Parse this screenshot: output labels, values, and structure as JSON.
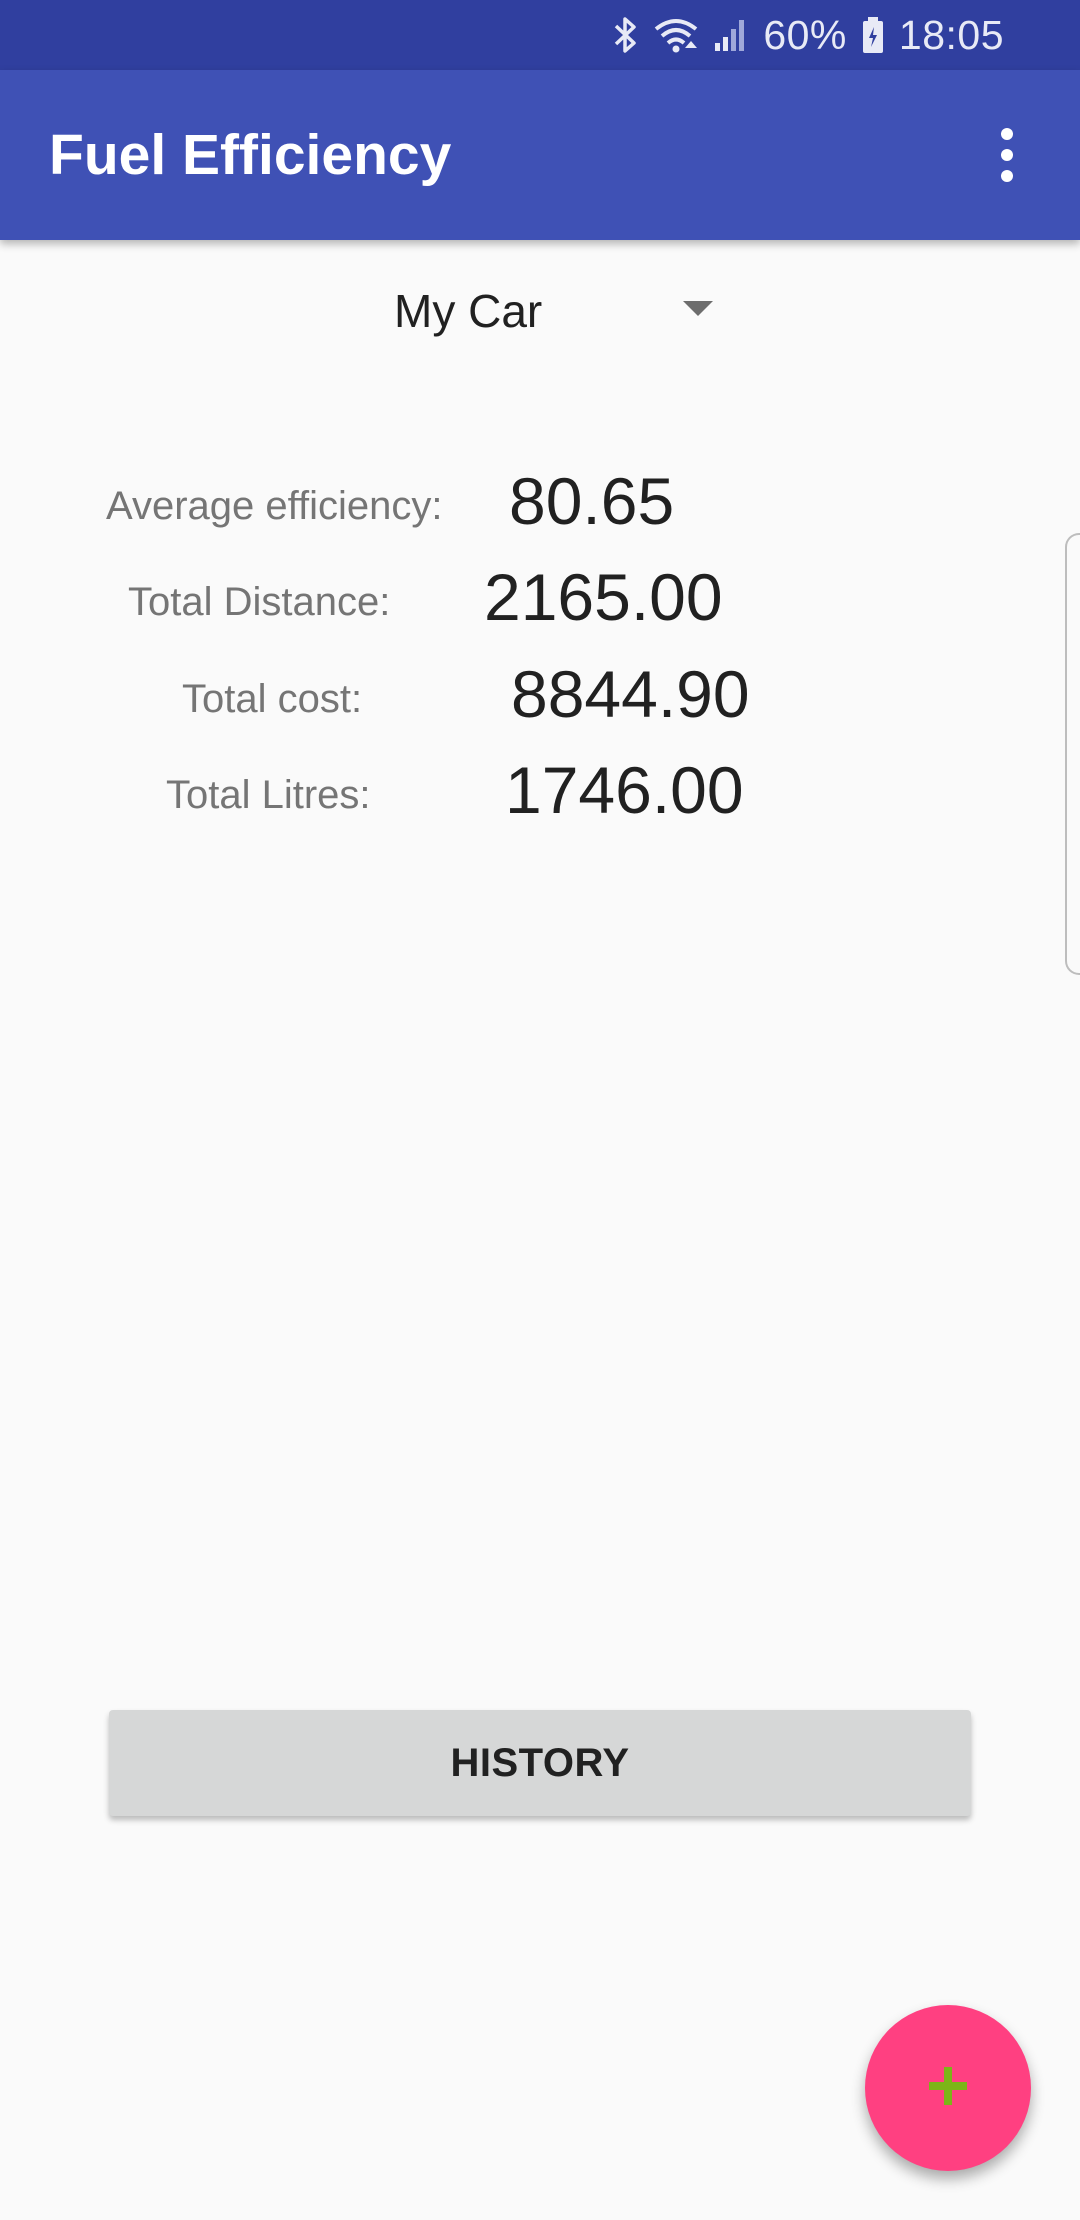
{
  "status_bar": {
    "battery": "60%",
    "time": "18:05",
    "icons": [
      "bluetooth-icon",
      "wifi-icon",
      "signal-icon",
      "battery-icon"
    ]
  },
  "app_bar": {
    "title": "Fuel Efficiency",
    "menu_icon": "more-vert-icon"
  },
  "vehicle_selector": {
    "selected": "My Car",
    "icon": "dropdown-arrow-icon"
  },
  "stats": {
    "average_efficiency": {
      "label": "Average efficiency:",
      "value": "80.65"
    },
    "total_distance": {
      "label": "Total Distance:",
      "value": "2165.00"
    },
    "total_cost": {
      "label": "Total cost:",
      "value": "8844.90"
    },
    "total_litres": {
      "label": "Total Litres:",
      "value": "1746.00"
    }
  },
  "history_button": {
    "label": "HISTORY"
  },
  "fab": {
    "icon": "add-icon"
  },
  "colors": {
    "status_bar": "#303f9f",
    "app_bar": "#3f51b5",
    "fab": "#ff4081",
    "fab_icon": "#7cb518",
    "background": "#fafafa",
    "button": "#d6d7d7"
  }
}
